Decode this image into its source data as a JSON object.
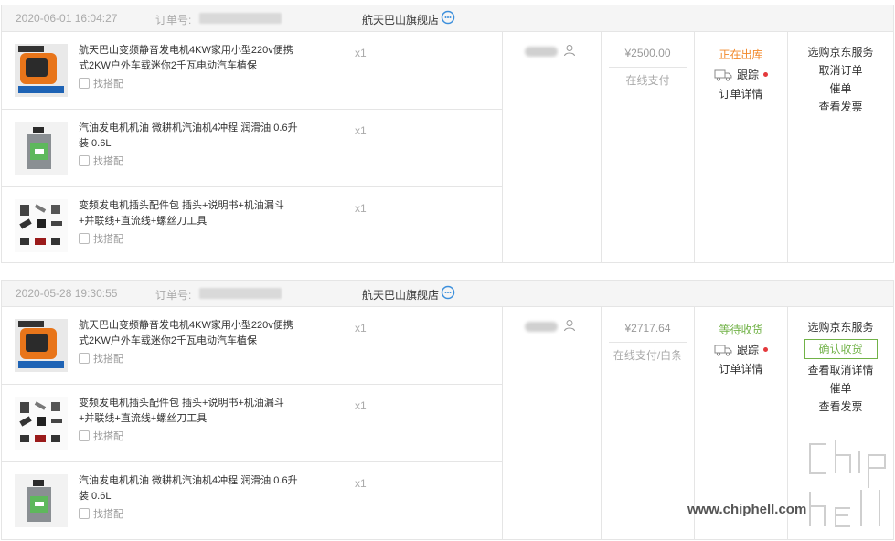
{
  "orders": [
    {
      "date": "2020-06-01 16:04:27",
      "order_no_label": "订单号:",
      "shop": "航天巴山旗舰店",
      "items": [
        {
          "title": "航天巴山变频静音发电机4KW家用小型220v便携式2KW户外车载迷你2千瓦电动汽车植保",
          "find": "找搭配",
          "qty": "x1",
          "thumb": "generator"
        },
        {
          "title": "汽油发电机机油 微耕机汽油机4冲程 润滑油 0.6升装 0.6L",
          "find": "找搭配",
          "qty": "x1",
          "thumb": "oil"
        },
        {
          "title": "变频发电机插头配件包 插头+说明书+机油漏斗+并联线+直流线+螺丝刀工具",
          "find": "找搭配",
          "qty": "x1",
          "thumb": "parts"
        }
      ],
      "amount": "¥2500.00",
      "payment": "在线支付",
      "status": "正在出库",
      "status_color": "#f2892b",
      "track": "跟踪",
      "detail": "订单详情",
      "ops": [
        "选购京东服务",
        "取消订单",
        "催单",
        "查看发票"
      ]
    },
    {
      "date": "2020-05-28 19:30:55",
      "order_no_label": "订单号:",
      "shop": "航天巴山旗舰店",
      "items": [
        {
          "title": "航天巴山变频静音发电机4KW家用小型220v便携式2KW户外车载迷你2千瓦电动汽车植保",
          "find": "找搭配",
          "qty": "x1",
          "thumb": "generator"
        },
        {
          "title": "变频发电机插头配件包 插头+说明书+机油漏斗+并联线+直流线+螺丝刀工具",
          "find": "找搭配",
          "qty": "x1",
          "thumb": "parts"
        },
        {
          "title": "汽油发电机机油 微耕机汽油机4冲程 润滑油 0.6升装 0.6L",
          "find": "找搭配",
          "qty": "x1",
          "thumb": "oil"
        }
      ],
      "amount": "¥2717.64",
      "payment": "在线支付/白条",
      "status": "等待收货",
      "status_color": "#71b247",
      "track": "跟踪",
      "detail": "订单详情",
      "ops_first": "选购京东服务",
      "confirm": "确认收货",
      "ops": [
        "查看取消详情",
        "催单",
        "查看发票"
      ]
    }
  ],
  "watermark": {
    "url": "www.chiphell.com",
    "logo": "chip hell"
  }
}
